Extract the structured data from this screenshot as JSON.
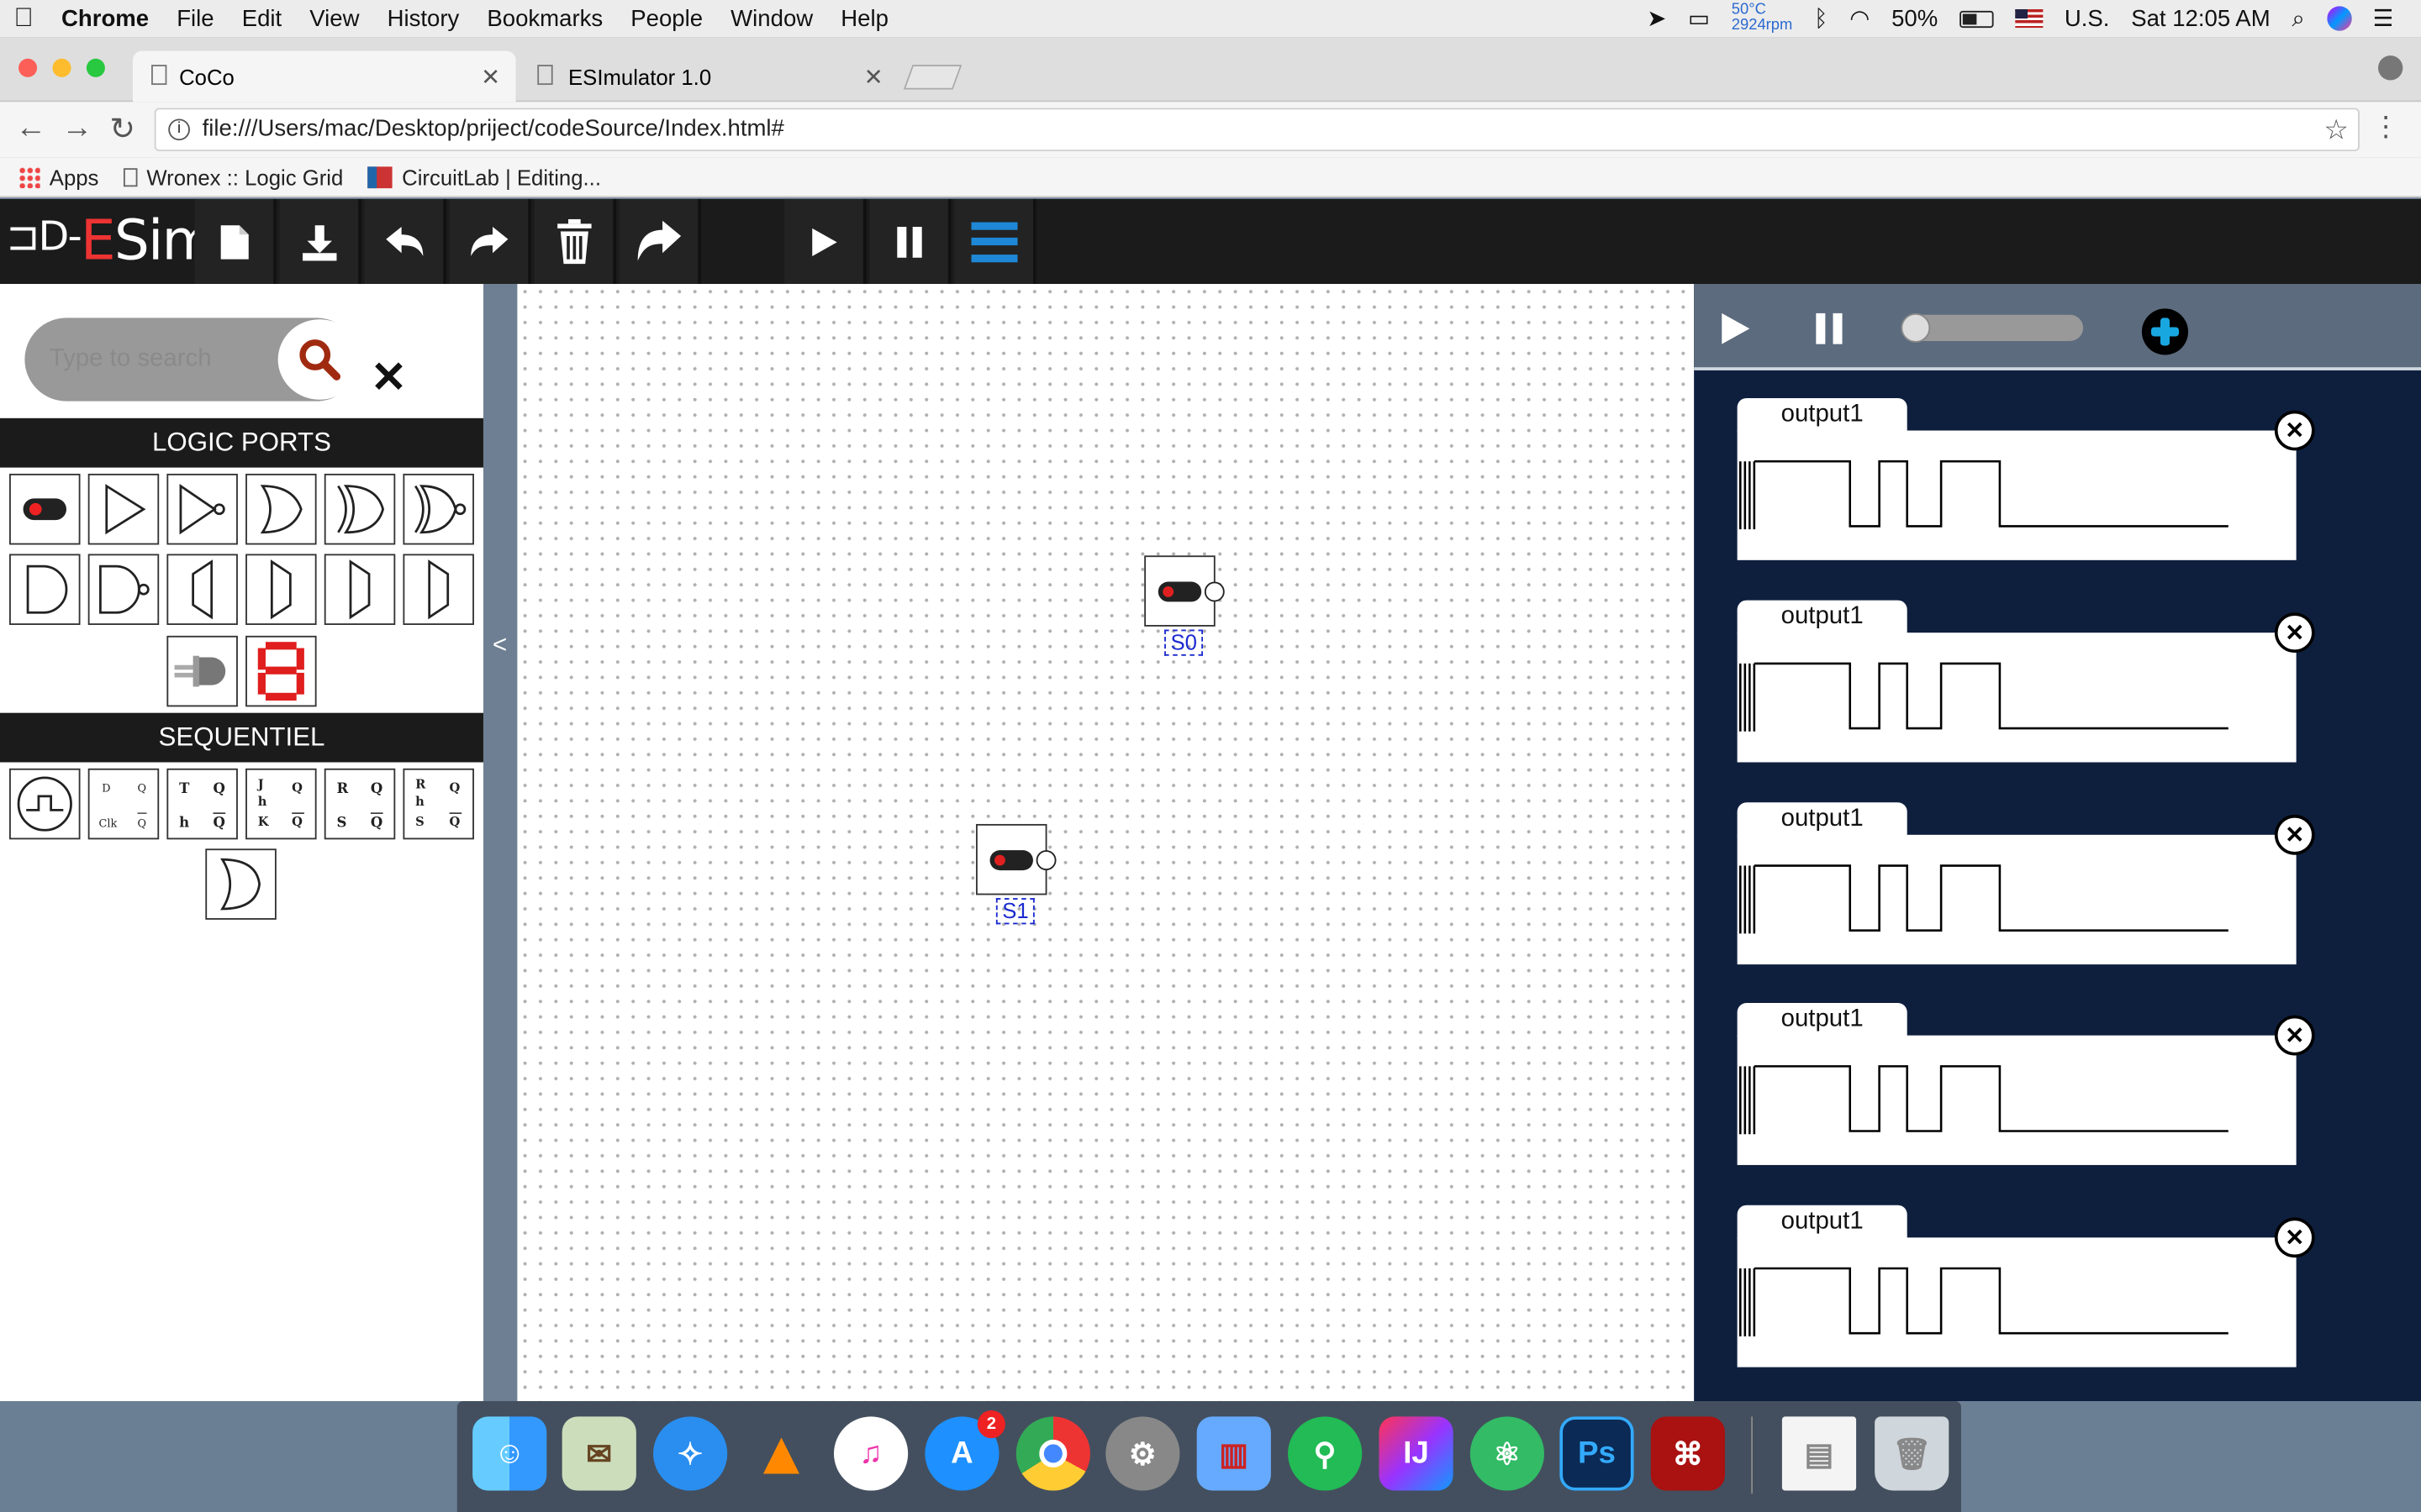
{
  "menubar": {
    "app": "Chrome",
    "items": [
      "File",
      "Edit",
      "View",
      "History",
      "Bookmarks",
      "People",
      "Window",
      "Help"
    ],
    "temp": "50°C",
    "rpm": "2924rpm",
    "battery": "50%",
    "input": "U.S.",
    "clock": "Sat 12:05 AM"
  },
  "tabs": [
    {
      "title": "CoCo"
    },
    {
      "title": "ESImulator 1.0"
    }
  ],
  "address": {
    "url": "file:///Users/mac/Desktop/priject/codeSource/Index.html#"
  },
  "bookmarks": [
    "Apps",
    "Wronex :: Logic Grid",
    "CircuitLab | Editing..."
  ],
  "app": {
    "logo": "ESim",
    "toolbar": [
      "new-file",
      "download",
      "undo",
      "redo",
      "delete",
      "share",
      "play",
      "pause",
      "menu"
    ]
  },
  "sidebar": {
    "search_placeholder": "Type to search",
    "logic_header": "LOGIC PORTS",
    "seq_header": "SEQUENTIEL",
    "collapse": "<"
  },
  "canvas": {
    "switches": [
      {
        "label": "S0"
      },
      {
        "label": "S1"
      }
    ]
  },
  "signals": {
    "panels": [
      {
        "name": "output1"
      },
      {
        "name": "output1"
      },
      {
        "name": "output1"
      },
      {
        "name": "output1"
      },
      {
        "name": "output1"
      }
    ]
  },
  "dock": {
    "badge": "2"
  }
}
